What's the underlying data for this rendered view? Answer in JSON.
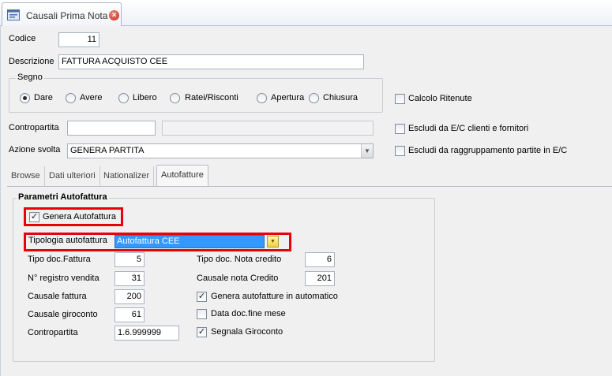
{
  "document_tab": {
    "title": "Causali Prima Nota",
    "icon": "form-icon",
    "close_icon": "close-icon"
  },
  "form": {
    "codice_label": "Codice",
    "codice_value": "11",
    "descrizione_label": "Descrizione",
    "descrizione_value": "FATTURA ACQUISTO CEE",
    "segno": {
      "title": "Segno",
      "options": [
        "Dare",
        "Avere",
        "Libero",
        "Ratei/Risconti",
        "Apertura",
        "Chiusura"
      ],
      "selected": "Dare"
    },
    "calcolo_ritenute_label": "Calcolo Ritenute",
    "calcolo_ritenute_checked": false,
    "contropartita_label": "Contropartita",
    "contropartita_value": "",
    "contropartita_desc": "",
    "escludi_ec_label": "Escludi da E/C clienti e fornitori",
    "escludi_ec_checked": false,
    "azione_label": "Azione svolta",
    "azione_value": "GENERA PARTITA",
    "escludi_raggr_label": "Escludi da raggruppamento partite in E/C",
    "escludi_raggr_checked": false
  },
  "tabs": [
    "Browse",
    "Dati ulteriori",
    "Nationalizer",
    "Autofatture"
  ],
  "active_tab": "Autofatture",
  "autofattura": {
    "group_title": "Parametri Autofattura",
    "genera_label": "Genera Autofattura",
    "genera_checked": true,
    "tipologia_label": "Tipologia autofattura",
    "tipologia_value": "Autofattura CEE",
    "tipo_doc_fattura_label": "Tipo doc.Fattura",
    "tipo_doc_fattura_value": "5",
    "registro_vendita_label": "N° registro vendita",
    "registro_vendita_value": "31",
    "causale_fattura_label": "Causale fattura",
    "causale_fattura_value": "200",
    "causale_giroconto_label": "Causale giroconto",
    "causale_giroconto_value": "61",
    "contropartita_label": "Contropartita",
    "contropartita_value": "1.6.999999",
    "tipo_doc_nota_label": "Tipo doc. Nota credito",
    "tipo_doc_nota_value": "6",
    "causale_nota_label": "Causale nota Credito",
    "causale_nota_value": "201",
    "auto_label": "Genera autofatture in automatico",
    "auto_checked": true,
    "fine_mese_label": "Data doc.fine mese",
    "fine_mese_checked": false,
    "segnala_label": "Segnala Giroconto",
    "segnala_checked": true
  },
  "colors": {
    "highlight": "#e8000b",
    "selection": "#3399ff"
  }
}
